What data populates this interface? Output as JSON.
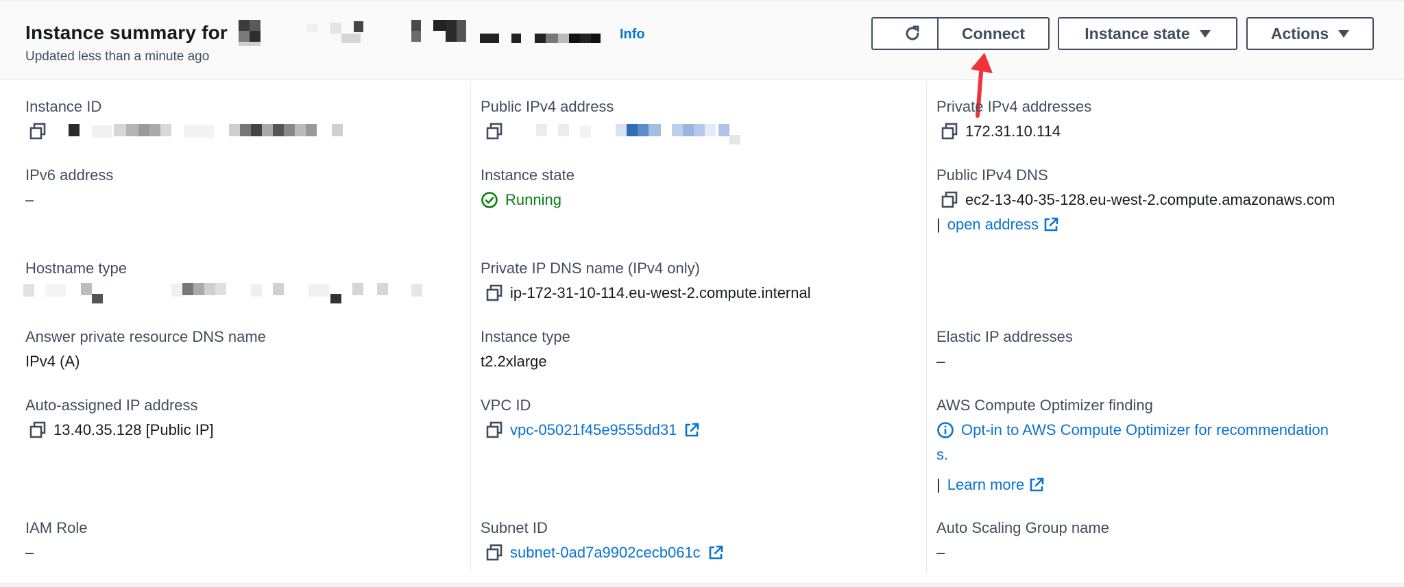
{
  "header": {
    "title": "Instance summary for",
    "info": "Info",
    "updated": "Updated less than a minute ago",
    "buttons": {
      "connect": "Connect",
      "instance_state": "Instance state",
      "actions": "Actions"
    }
  },
  "col1": {
    "instance_id_label": "Instance ID",
    "ipv6_label": "IPv6 address",
    "ipv6_value": "–",
    "hostname_type_label": "Hostname type",
    "answer_dns_label": "Answer private resource DNS name",
    "answer_dns_value": "IPv4 (A)",
    "auto_ip_label": "Auto-assigned IP address",
    "auto_ip_value": "13.40.35.128 [Public IP]",
    "iam_label": "IAM Role",
    "iam_value": "–"
  },
  "col2": {
    "public_ipv4_label": "Public IPv4 address",
    "instance_state_label": "Instance state",
    "instance_state_value": "Running",
    "private_dns_label": "Private IP DNS name (IPv4 only)",
    "private_dns_value": "ip-172-31-10-114.eu-west-2.compute.internal",
    "instance_type_label": "Instance type",
    "instance_type_value": "t2.2xlarge",
    "vpc_label": "VPC ID",
    "vpc_value": "vpc-05021f45e9555dd31",
    "subnet_label": "Subnet ID",
    "subnet_value": "subnet-0ad7a9902cecb061c"
  },
  "col3": {
    "private_ipv4_label": "Private IPv4 addresses",
    "private_ipv4_value": "172.31.10.114",
    "public_dns_label": "Public IPv4 DNS",
    "public_dns_value": "ec2-13-40-35-128.eu-west-2.compute.amazonaws.com",
    "open_address": "open address",
    "bar": "|",
    "elastic_label": "Elastic IP addresses",
    "elastic_value": "–",
    "optimizer_label": "AWS Compute Optimizer finding",
    "optimizer_line1": "Opt-in to AWS Compute Optimizer for recommendation",
    "optimizer_line2": "s.",
    "learn_more": "Learn more",
    "asg_label": "Auto Scaling Group name",
    "asg_value": "–"
  },
  "colors": {
    "link": "#0972d3",
    "running": "#037f0c",
    "annotation_arrow": "#f0333a"
  },
  "icons": [
    "refresh-icon",
    "caret-down-icon",
    "copy-icon",
    "external-link-icon",
    "status-ok-icon",
    "info-icon"
  ]
}
